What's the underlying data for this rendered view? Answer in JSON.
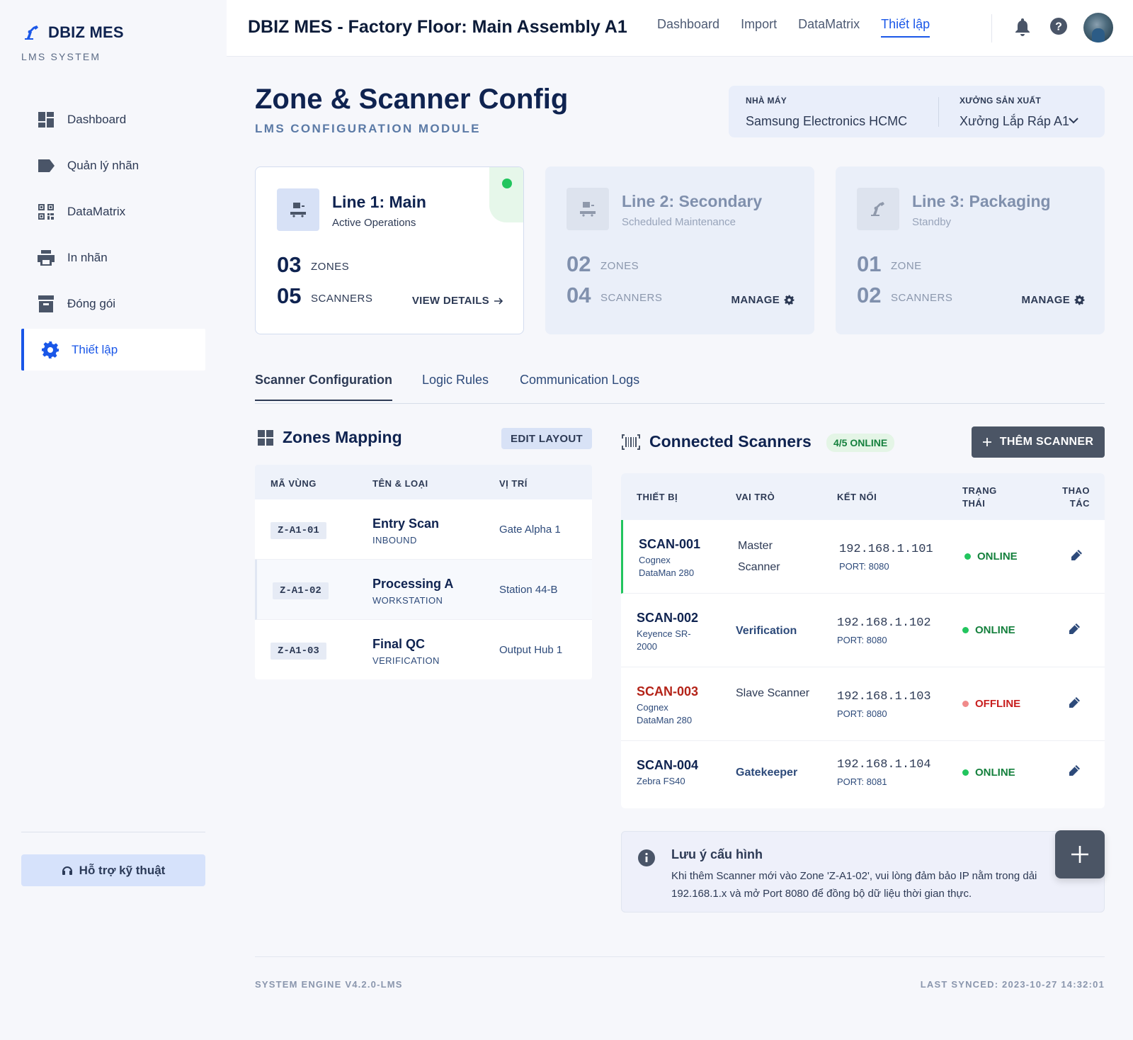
{
  "brand": {
    "name": "DBIZ MES",
    "subtitle": "LMS SYSTEM",
    "logo_icon": "robot-arm-icon"
  },
  "sidebar": {
    "items": [
      {
        "label": "Dashboard",
        "icon": "dashboard-icon"
      },
      {
        "label": "Quản lý nhãn",
        "icon": "label-icon"
      },
      {
        "label": "DataMatrix",
        "icon": "qr-code-icon"
      },
      {
        "label": "In nhãn",
        "icon": "printer-icon"
      },
      {
        "label": "Đóng gói",
        "icon": "archive-box-icon"
      },
      {
        "label": "Thiết lập",
        "icon": "gear-icon",
        "active": true
      }
    ],
    "support_label": "Hỗ trợ kỹ thuật"
  },
  "topbar": {
    "title": "DBIZ MES - Factory Floor: Main Assembly A1",
    "nav": [
      "Dashboard",
      "Import",
      "DataMatrix",
      "Thiết lập"
    ],
    "active_nav": "Thiết lập"
  },
  "page": {
    "title": "Zone & Scanner Config",
    "subtitle": "LMS CONFIGURATION MODULE"
  },
  "selector": {
    "factory_label": "NHÀ MÁY",
    "factory_value": "Samsung Electronics HCMC",
    "workshop_label": "XƯỞNG SẢN XUẤT",
    "workshop_value": "Xưởng Lắp Ráp A1"
  },
  "lines": [
    {
      "name": "Line 1: Main",
      "status": "Active Operations",
      "zones": "03",
      "zones_unit": "ZONES",
      "scanners": "05",
      "scanners_unit": "SCANNERS",
      "action": "VIEW DETAILS"
    },
    {
      "name": "Line 2: Secondary",
      "status": "Scheduled Maintenance",
      "zones": "02",
      "zones_unit": "ZONES",
      "scanners": "04",
      "scanners_unit": "SCANNERS",
      "action": "MANAGE"
    },
    {
      "name": "Line 3: Packaging",
      "status": "Standby",
      "zones": "01",
      "zones_unit": "ZONE",
      "scanners": "02",
      "scanners_unit": "SCANNERS",
      "action": "MANAGE"
    }
  ],
  "tabs": [
    "Scanner Configuration",
    "Logic Rules",
    "Communication Logs"
  ],
  "zones": {
    "title": "Zones Mapping",
    "edit_label": "EDIT LAYOUT",
    "headers": [
      "MÃ VÙNG",
      "TÊN & LOẠI",
      "VỊ TRÍ"
    ],
    "rows": [
      {
        "code": "Z-A1-01",
        "name": "Entry Scan",
        "type": "INBOUND",
        "location": "Gate Alpha 1"
      },
      {
        "code": "Z-A1-02",
        "name": "Processing A",
        "type": "WORKSTATION",
        "location": "Station 44-B"
      },
      {
        "code": "Z-A1-03",
        "name": "Final QC",
        "type": "VERIFICATION",
        "location": "Output Hub 1"
      }
    ]
  },
  "scanners": {
    "title": "Connected Scanners",
    "badge": "4/5 ONLINE",
    "add_label": "THÊM SCANNER",
    "headers": [
      "THIẾT BỊ",
      "VAI TRÒ",
      "KẾT NỐI",
      "TRẠNG THÁI",
      "THAO TÁC"
    ],
    "rows": [
      {
        "id": "SCAN-001",
        "model": "Cognex DataMan 280",
        "role": "Master Scanner",
        "ip": "192.168.1.101",
        "port": "PORT: 8080",
        "status": "ONLINE"
      },
      {
        "id": "SCAN-002",
        "model": "Keyence SR-2000",
        "role": "Verification",
        "ip": "192.168.1.102",
        "port": "PORT: 8080",
        "status": "ONLINE"
      },
      {
        "id": "SCAN-003",
        "model": "Cognex DataMan 280",
        "role": "Slave Scanner",
        "ip": "192.168.1.103",
        "port": "PORT: 8080",
        "status": "OFFLINE"
      },
      {
        "id": "SCAN-004",
        "model": "Zebra FS40",
        "role": "Gatekeeper",
        "ip": "192.168.1.104",
        "port": "PORT: 8081",
        "status": "ONLINE"
      }
    ]
  },
  "note": {
    "title": "Lưu ý cấu hình",
    "text": "Khi thêm Scanner mới vào Zone 'Z-A1-02', vui lòng đảm bảo IP nằm trong dải 192.168.1.x và mở Port 8080 để đồng bộ dữ liệu thời gian thực."
  },
  "footer": {
    "version": "SYSTEM ENGINE V4.2.0-LMS",
    "synced": "LAST SYNCED: 2023-10-27 14:32:01"
  },
  "colors": {
    "accent": "#1a57e8",
    "online": "#22c55e",
    "offline": "#b42318",
    "navy": "#0f2350"
  }
}
